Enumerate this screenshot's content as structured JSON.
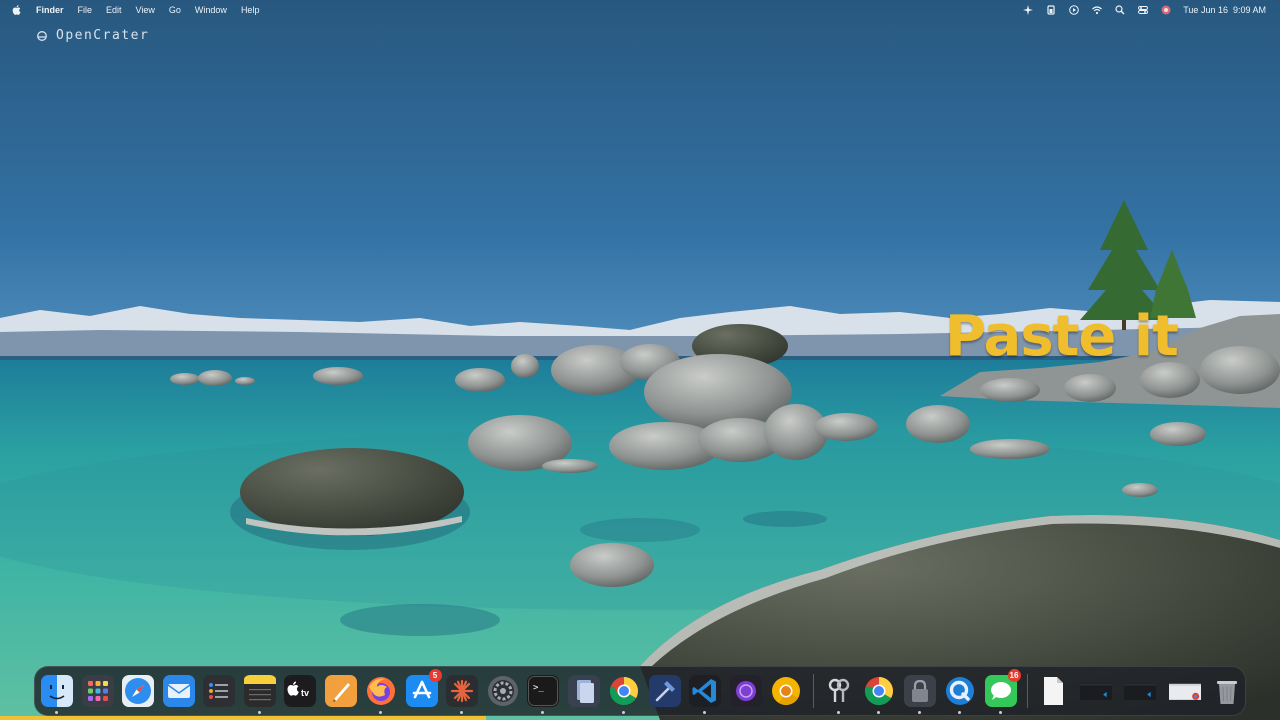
{
  "menubar": {
    "app_name": "Finder",
    "items": [
      "File",
      "Edit",
      "View",
      "Go",
      "Window",
      "Help"
    ],
    "status_icons": [
      "sparkle-icon",
      "battery-icon",
      "play-icon",
      "wifi-icon",
      "search-icon",
      "control-center-icon",
      "user-icon"
    ],
    "date": "Tue Jun 16",
    "time": "9:09 AM"
  },
  "watermark": {
    "brand": "OpenCrater"
  },
  "caption": {
    "text": "Paste it",
    "color": "#f0bd2c"
  },
  "dock": {
    "apps": [
      {
        "name": "finder",
        "icon": "finder-icon",
        "running": true
      },
      {
        "name": "launchpad",
        "icon": "launchpad-icon",
        "running": false
      },
      {
        "name": "safari",
        "icon": "safari-icon",
        "running": false
      },
      {
        "name": "mail",
        "icon": "mail-icon",
        "running": false
      },
      {
        "name": "reminders",
        "icon": "reminders-icon",
        "running": false
      },
      {
        "name": "notes",
        "icon": "notes-icon",
        "running": true
      },
      {
        "name": "apple-tv",
        "icon": "apple-tv-icon",
        "label": "tv",
        "running": false
      },
      {
        "name": "pages",
        "icon": "pages-icon",
        "running": false
      },
      {
        "name": "firefox",
        "icon": "firefox-icon",
        "running": true
      },
      {
        "name": "app-store",
        "icon": "app-store-icon",
        "badge": "5",
        "running": false
      },
      {
        "name": "claude",
        "icon": "sunburst-icon",
        "running": true
      },
      {
        "name": "system-settings",
        "icon": "gear-icon",
        "running": false
      },
      {
        "name": "terminal",
        "icon": "terminal-icon",
        "label": ">_",
        "running": true
      },
      {
        "name": "document-viewer",
        "icon": "document-icon",
        "running": false
      },
      {
        "name": "chrome",
        "icon": "chrome-icon",
        "running": true
      },
      {
        "name": "xcode",
        "icon": "hammer-icon",
        "running": false
      },
      {
        "name": "vscode",
        "icon": "vscode-icon",
        "running": true
      },
      {
        "name": "tor-browser",
        "icon": "purple-circle-icon",
        "running": false
      },
      {
        "name": "chrome-canary",
        "icon": "chrome-icon",
        "running": false
      }
    ],
    "apps_right": [
      {
        "name": "keychain",
        "icon": "keys-icon",
        "running": true
      },
      {
        "name": "chrome-alt",
        "icon": "chrome-icon",
        "running": true
      },
      {
        "name": "gpg-keychain",
        "icon": "lock-icon",
        "running": true
      },
      {
        "name": "quicktime",
        "icon": "quicktime-icon",
        "running": true
      },
      {
        "name": "messages",
        "icon": "messages-icon",
        "badge": "16",
        "running": true
      }
    ],
    "minimized": [
      {
        "name": "file-document",
        "icon": "file-icon"
      },
      {
        "name": "vscode-window",
        "icon": "window-thumbnail-icon"
      },
      {
        "name": "vscode-window-2",
        "icon": "window-thumbnail-icon"
      },
      {
        "name": "chrome-window",
        "icon": "window-thumbnail-icon"
      },
      {
        "name": "trash",
        "icon": "trash-icon"
      }
    ]
  },
  "colors": {
    "sky_top": "#2b5f8d",
    "water": "#2fa3a4",
    "dock_bg": "#1e2228",
    "accent_yellow": "#f0c231"
  }
}
